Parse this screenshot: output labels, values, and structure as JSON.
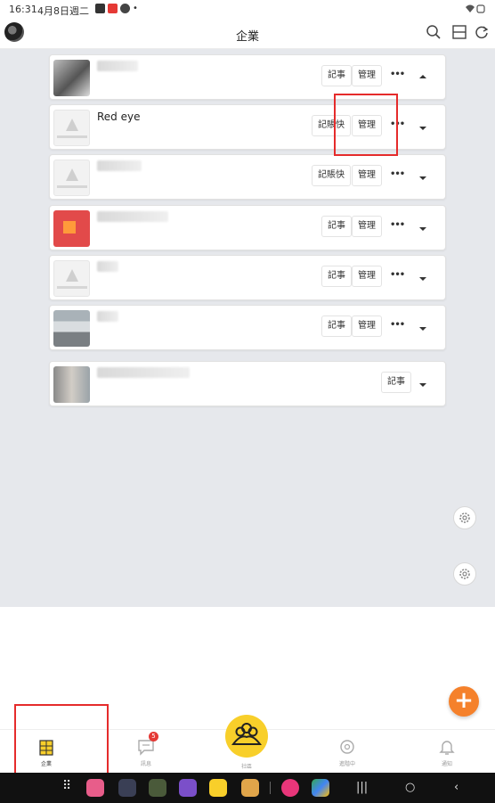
{
  "status_bar": {
    "time": "16:31",
    "date": "4月8日週二"
  },
  "header": {
    "title": "企業"
  },
  "companies": [
    {
      "name": "",
      "btn1": "記事",
      "btn2": "管理",
      "more": "•••"
    },
    {
      "name": "Red eye",
      "btn1": "記賬快",
      "btn2": "管理",
      "more": "•••"
    },
    {
      "name": "",
      "btn1": "記賬快",
      "btn2": "管理",
      "more": "•••"
    },
    {
      "name": "",
      "btn1": "記事",
      "btn2": "管理",
      "more": "•••"
    },
    {
      "name": "",
      "btn1": "記事",
      "btn2": "管理",
      "more": "•••"
    },
    {
      "name": "",
      "btn1": "記事",
      "btn2": "管理",
      "more": "•••"
    },
    {
      "name": "",
      "btn1": "記事"
    }
  ],
  "fab": {
    "label": "+"
  },
  "bottom_nav": {
    "items": [
      {
        "label": "企業"
      },
      {
        "label": "訊息",
        "badge": "5"
      },
      {
        "label": "社區"
      },
      {
        "label": "進階中"
      },
      {
        "label": "通知"
      }
    ]
  },
  "colors": {
    "accent_orange": "#f5812b",
    "accent_yellow": "#f8cf2a",
    "highlight_red": "#e52b2b"
  }
}
